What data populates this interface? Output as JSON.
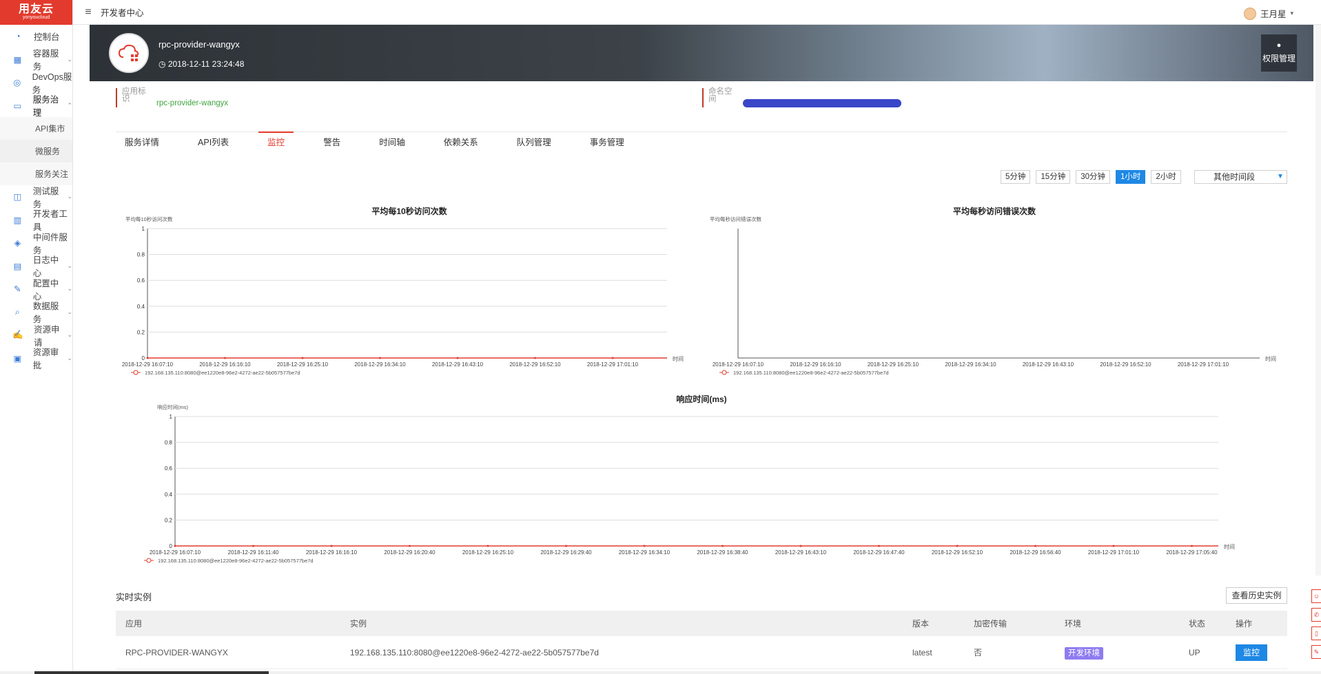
{
  "brand": {
    "name": "用友云",
    "sub": "yonyoucloud"
  },
  "sidebar": {
    "items": [
      {
        "label": "控制台",
        "icon": "dashboard-icon",
        "chev": false
      },
      {
        "label": "容器服务",
        "icon": "container-icon",
        "chev": true
      },
      {
        "label": "DevOps服务",
        "icon": "devops-icon",
        "chev": false
      },
      {
        "label": "服务治理",
        "icon": "service-governance-icon",
        "chev": true,
        "expanded": true
      }
    ],
    "sub_items": [
      "API集市",
      "微服务",
      "服务关注"
    ],
    "items2": [
      {
        "label": "测试服务",
        "icon": "test-icon",
        "chev": true
      },
      {
        "label": "开发者工具",
        "icon": "tools-icon",
        "chev": false
      },
      {
        "label": "中间件服务",
        "icon": "middleware-icon",
        "chev": false
      },
      {
        "label": "日志中心",
        "icon": "log-icon",
        "chev": true
      },
      {
        "label": "配置中心",
        "icon": "config-icon",
        "chev": true
      },
      {
        "label": "数据服务",
        "icon": "data-icon",
        "chev": true
      },
      {
        "label": "资源申请",
        "icon": "resource-request-icon",
        "chev": true
      },
      {
        "label": "资源审批",
        "icon": "resource-approve-icon",
        "chev": true
      }
    ]
  },
  "topbar": {
    "title": "开发者中心",
    "user": "王月星"
  },
  "banner": {
    "app_name": "rpc-provider-wangyx",
    "created": "2018-12-11 23:24:48",
    "perm_label": "权限管理"
  },
  "info": {
    "app_id_label": "应用标识",
    "app_id_value": "rpc-provider-wangyx",
    "namespace_label": "命名空间"
  },
  "tabs": [
    "服务详情",
    "API列表",
    "监控",
    "警告",
    "时间轴",
    "依赖关系",
    "队列管理",
    "事务管理"
  ],
  "time_range": {
    "buttons": [
      "5分钟",
      "15分钟",
      "30分钟",
      "1小时",
      "2小时"
    ],
    "active": "1小时",
    "other": "其他时间段"
  },
  "charts": {
    "c1": {
      "title": "平均每10秒访问次数",
      "ylabel": "平均每10秒访问次数",
      "xlabel": "时间"
    },
    "c2": {
      "title": "平均每秒访问错误次数",
      "ylabel": "平均每秒访问错误次数",
      "xlabel": "时间"
    },
    "c3": {
      "title": "响应时间(ms)",
      "ylabel": "响应时间(ms)",
      "xlabel": "时间"
    }
  },
  "chart_data": [
    {
      "type": "line",
      "title": "平均每10秒访问次数",
      "ylabel": "平均每10秒访问次数",
      "xlabel": "时间",
      "ylim": [
        0,
        1
      ],
      "yticks": [
        "0",
        "0.2",
        "0.4",
        "0.6",
        "0.8",
        "1"
      ],
      "categories": [
        "2018-12-29 16:07:10",
        "2018-12-29 16:16:10",
        "2018-12-29 16:25:10",
        "2018-12-29 16:34:10",
        "2018-12-29 16:43:10",
        "2018-12-29 16:52:10",
        "2018-12-29 17:01:10"
      ],
      "series": [
        {
          "name": "192.168.135.110:8080@ee1220e8-96e2-4272-ae22-5b057577be7d",
          "values": [
            0,
            0,
            0,
            0,
            0,
            0,
            0
          ]
        }
      ]
    },
    {
      "type": "line",
      "title": "平均每秒访问错误次数",
      "ylabel": "平均每秒访问错误次数",
      "xlabel": "时间",
      "categories": [
        "2018-12-29 16:07:10",
        "2018-12-29 16:16:10",
        "2018-12-29 16:25:10",
        "2018-12-29 16:34:10",
        "2018-12-29 16:43:10",
        "2018-12-29 16:52:10",
        "2018-12-29 17:01:10"
      ],
      "series": [
        {
          "name": "192.168.135.110:8080@ee1220e8-96e2-4272-ae22-5b057577be7d",
          "values": []
        }
      ]
    },
    {
      "type": "line",
      "title": "响应时间(ms)",
      "ylabel": "响应时间(ms)",
      "xlabel": "时间",
      "ylim": [
        0,
        1
      ],
      "yticks": [
        "0",
        "0.2",
        "0.4",
        "0.6",
        "0.8",
        "1"
      ],
      "categories": [
        "2018-12-29 16:07:10",
        "2018-12-29 16:11:40",
        "2018-12-29 16:16:10",
        "2018-12-29 16:20:40",
        "2018-12-29 16:25:10",
        "2018-12-29 16:29:40",
        "2018-12-29 16:34:10",
        "2018-12-29 16:38:40",
        "2018-12-29 16:43:10",
        "2018-12-29 16:47:40",
        "2018-12-29 16:52:10",
        "2018-12-29 16:56:40",
        "2018-12-29 17:01:10",
        "2018-12-29 17:05:40"
      ],
      "series": [
        {
          "name": "192.168.135.110:8080@ee1220e8-96e2-4272-ae22-5b057577be7d",
          "values": [
            0,
            0,
            0,
            0,
            0,
            0,
            0,
            0,
            0,
            0,
            0,
            0,
            0,
            0
          ]
        }
      ]
    }
  ],
  "instances": {
    "title": "实时实例",
    "history_btn": "查看历史实例",
    "columns": [
      "应用",
      "实例",
      "版本",
      "加密传输",
      "环境",
      "状态",
      "操作"
    ],
    "rows": [
      {
        "app": "RPC-PROVIDER-WANGYX",
        "instance": "192.168.135.110:8080@ee1220e8-96e2-4272-ae22-5b057577be7d",
        "version": "latest",
        "encrypted": "否",
        "env": "开发环境",
        "status": "UP",
        "action": "监控"
      }
    ]
  },
  "colors": {
    "brand": "#e23b2e",
    "primary": "#1e88e5",
    "env_badge": "#8e7cf0",
    "link_green": "#3fa53f"
  }
}
